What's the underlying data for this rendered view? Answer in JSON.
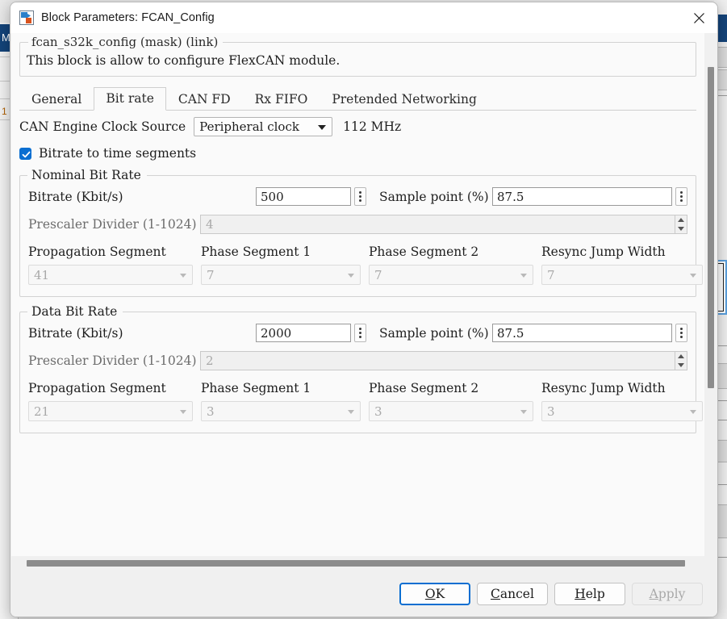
{
  "background": {
    "left_marker": "M",
    "left_number": "1"
  },
  "dialog": {
    "title": "Block Parameters: FCAN_Config",
    "icon": "simulink-block-icon",
    "close_icon": "close-icon"
  },
  "mask": {
    "header": "fcan_s32k_config (mask) (link)",
    "description": "This block is allow to configure FlexCAN module."
  },
  "tabs": [
    {
      "label": "General",
      "active": false
    },
    {
      "label": "Bit rate",
      "active": true
    },
    {
      "label": "CAN FD",
      "active": false
    },
    {
      "label": "Rx FIFO",
      "active": false
    },
    {
      "label": "Pretended Networking",
      "active": false
    }
  ],
  "clock": {
    "label": "CAN Engine Clock Source",
    "value": "Peripheral clock",
    "frequency": "112 MHz"
  },
  "bitrate_checkbox": {
    "label": "Bitrate to time segments",
    "checked": true
  },
  "groups": [
    {
      "title": "Nominal Bit Rate",
      "bitrate_label": "Bitrate (Kbit/s)",
      "bitrate_value": "500",
      "sample_point_label": "Sample point (%)",
      "sample_point_value": "87.5",
      "prescaler_label": "Prescaler Divider (1-1024)",
      "prescaler_value": "4",
      "seg_headers": [
        "Propagation Segment",
        "Phase Segment 1",
        "Phase Segment 2",
        "Resync Jump Width"
      ],
      "seg_values": [
        "41",
        "7",
        "7",
        "7"
      ]
    },
    {
      "title": "Data Bit Rate",
      "bitrate_label": "Bitrate (Kbit/s)",
      "bitrate_value": "2000",
      "sample_point_label": "Sample point (%)",
      "sample_point_value": "87.5",
      "prescaler_label": "Prescaler Divider (1-1024)",
      "prescaler_value": "2",
      "seg_headers": [
        "Propagation Segment",
        "Phase Segment 1",
        "Phase Segment 2",
        "Resync Jump Width"
      ],
      "seg_values": [
        "21",
        "3",
        "3",
        "3"
      ]
    }
  ],
  "buttons": {
    "ok": "OK",
    "ok_mnemonic": "O",
    "ok_rest": "K",
    "cancel_mnemonic": "C",
    "cancel_rest": "ancel",
    "help_mnemonic": "H",
    "help_rest": "elp",
    "apply_mnemonic": "A",
    "apply_rest": "pply",
    "apply_disabled": true
  },
  "colors": {
    "accent": "#0a6ed1",
    "scrollbar": "#8c8c8c",
    "panel": "#fafafa",
    "chrome": "#f0f0f0"
  }
}
